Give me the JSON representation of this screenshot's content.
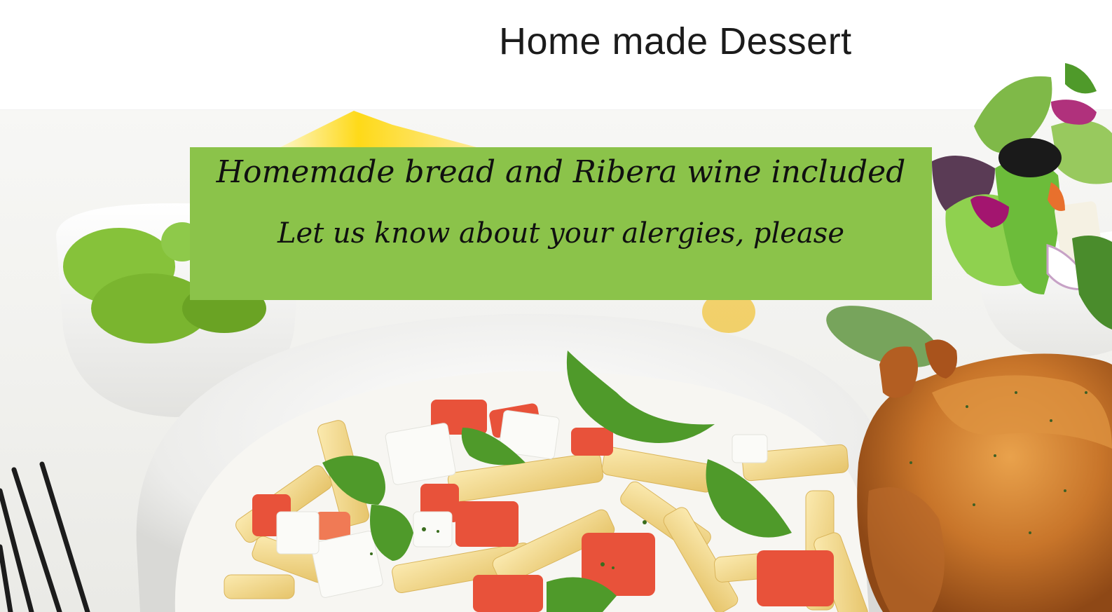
{
  "header": {
    "title": "Home made Dessert"
  },
  "banner": {
    "line1": "Homemade bread and Ribera wine included",
    "line2": "Let us know about your alergies, please",
    "color": "#8bc34a"
  },
  "images": {
    "background": "pasta-salad-photo",
    "salad": "green-salad-bowl",
    "chicken": "roast-chicken",
    "fork": "fork-icon",
    "basil_bowl": "basil-bowl"
  }
}
